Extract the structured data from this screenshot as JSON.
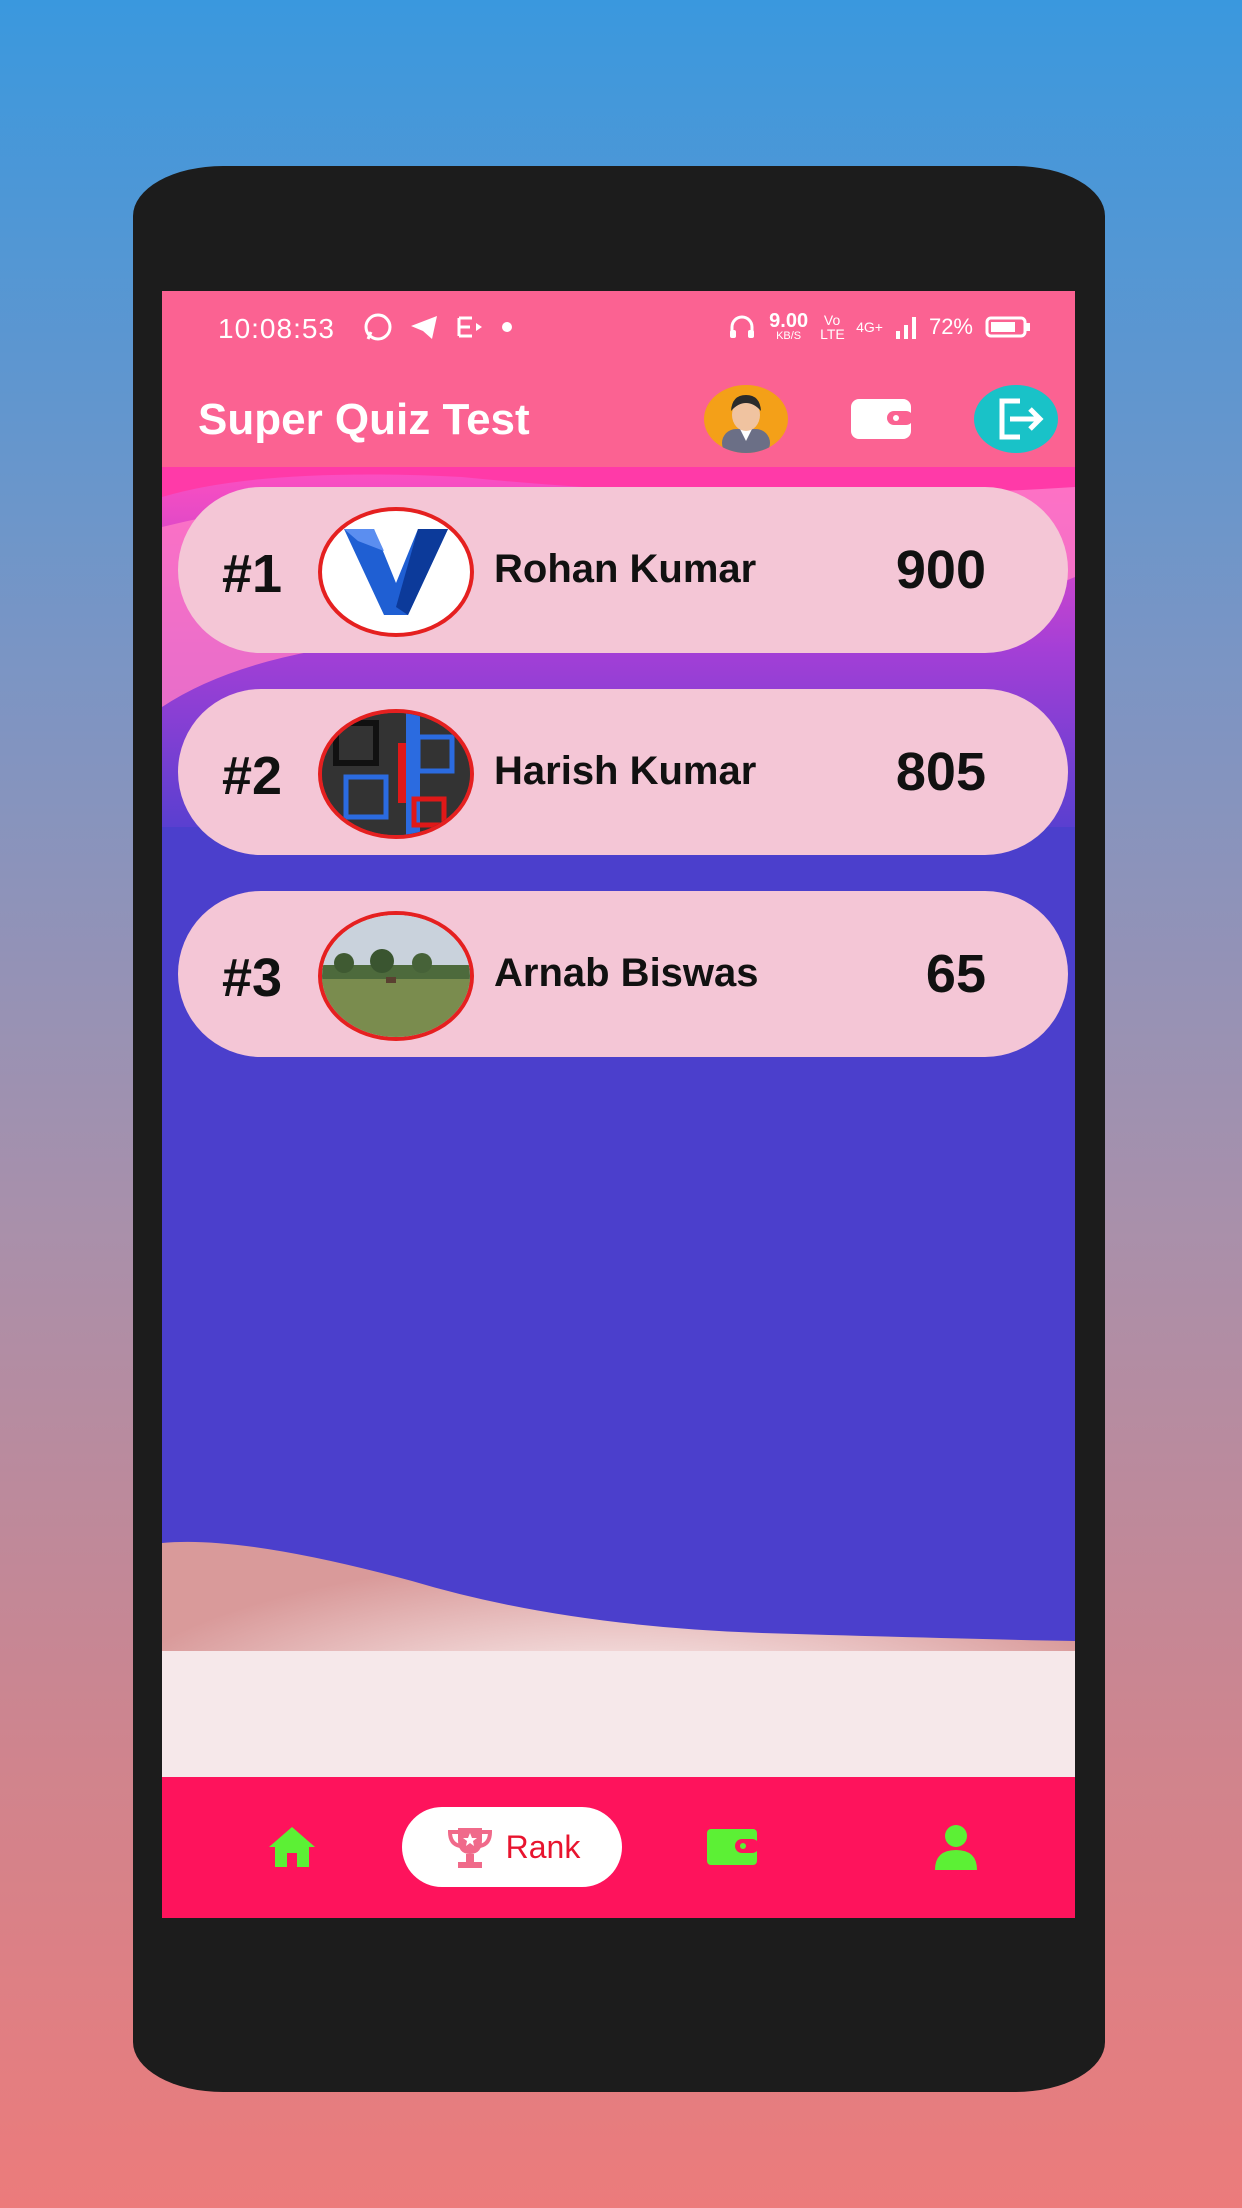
{
  "status_bar": {
    "time": "10:08:53",
    "network_speed": "9.00",
    "speed_unit": "KB/S",
    "volte": "Vo LTE",
    "network": "4G+",
    "battery": "72%"
  },
  "app_bar": {
    "title": "Super Quiz Test"
  },
  "leaderboard": [
    {
      "rank": "#1",
      "name": "Rohan Kumar",
      "score": "900"
    },
    {
      "rank": "#2",
      "name": "Harish Kumar",
      "score": "805"
    },
    {
      "rank": "#3",
      "name": "Arnab Biswas",
      "score": "65"
    }
  ],
  "nav": {
    "rank_label": "Rank",
    "active_tab": "rank"
  },
  "colors": {
    "background_top": "#3a98de",
    "background_bottom": "#ec7b7b",
    "app_bar": "#fb6292",
    "screen_body": "#4b3fcc",
    "card": "#f4c6d6",
    "nav_bar": "#fe135c",
    "nav_icon": "#5cf035",
    "avatar_border": "#e52020"
  }
}
